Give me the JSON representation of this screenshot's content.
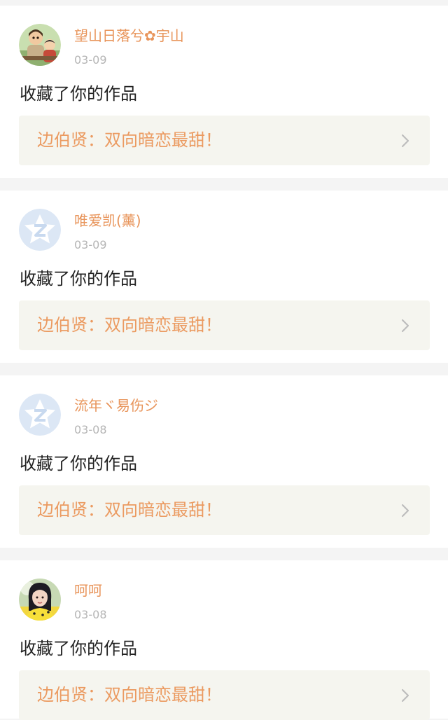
{
  "notifications": [
    {
      "username": "望山日落兮✿宇山",
      "date": "03-09",
      "action": "收藏了你的作品",
      "work_title": "边伯贤：双向暗恋最甜！",
      "avatar_icon": "cartoon-kids-avatar"
    },
    {
      "username": "唯爱凯(薰)",
      "date": "03-09",
      "action": "收藏了你的作品",
      "work_title": "边伯贤：双向暗恋最甜！",
      "avatar_icon": "default-star-avatar"
    },
    {
      "username": "流年ヾ易伤ジ",
      "date": "03-08",
      "action": "收藏了你的作品",
      "work_title": "边伯贤：双向暗恋最甜！",
      "avatar_icon": "default-star-avatar"
    },
    {
      "username": "呵呵",
      "date": "03-08",
      "action": "收藏了你的作品",
      "work_title": "边伯贤：双向暗恋最甜！",
      "avatar_icon": "girl-photo-avatar"
    }
  ],
  "colors": {
    "username": "#e8945a",
    "work_title": "#eb9a60",
    "date": "#b5b5b5",
    "card_background": "#ffffff",
    "page_background": "#f4f4f4",
    "work_link_background": "#f5f5ef"
  }
}
